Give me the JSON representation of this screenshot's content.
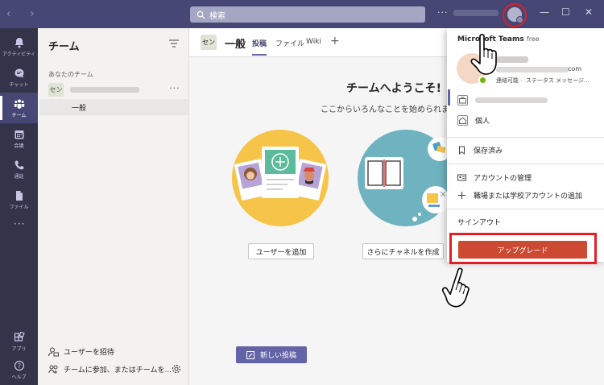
{
  "titlebar": {
    "search_placeholder": "検索",
    "more": "···"
  },
  "rail": {
    "items": [
      {
        "label": "アクティビティ"
      },
      {
        "label": "チャット"
      },
      {
        "label": "チーム"
      },
      {
        "label": "会議"
      },
      {
        "label": "通話"
      },
      {
        "label": "ファイル"
      },
      {
        "label": "アプリ"
      },
      {
        "label": "ヘルプ"
      }
    ],
    "more": "···"
  },
  "panel": {
    "title": "チーム",
    "section": "あなたのチーム",
    "team_badge": "セン",
    "channel": "一般",
    "invite": "ユーザーを招待",
    "join": "チームに参加、またはチームを..."
  },
  "channel": {
    "badge": "セン",
    "name": "一般",
    "tabs": [
      "投稿",
      "ファイル",
      "Wiki"
    ],
    "add": "+"
  },
  "welcome": {
    "title": "チームへようこそ!",
    "subtitle": "ここからいろんなことを始められます",
    "add_user": "ユーザーを追加",
    "create_channel": "さらにチャネルを作成",
    "new_post": "新しい投稿"
  },
  "dropdown": {
    "title": "Microsoft Teams",
    "plan": "free",
    "email_suffix": "com",
    "status": "連絡可能",
    "status_message": "ステータス メッセージ...",
    "personal": "個人",
    "saved": "保存済み",
    "manage_account": "アカウントの管理",
    "add_account": "職場または学校アカウントの追加",
    "sign_out": "サインアウト",
    "upgrade": "アップグレード"
  },
  "colors": {
    "titlebar": "#464775",
    "rail": "#33344a",
    "accent": "#6264a7",
    "upgrade": "#cc4a31",
    "highlight": "#e31e24"
  }
}
